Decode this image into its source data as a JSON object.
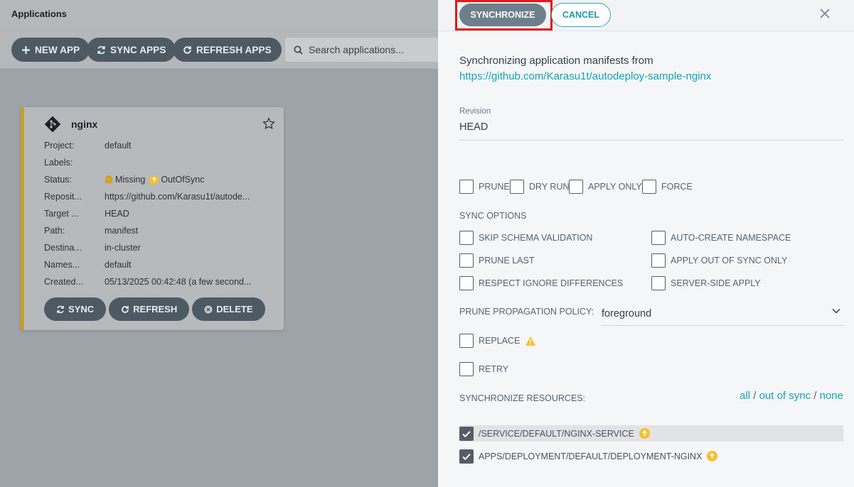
{
  "app_page": {
    "title": "Applications",
    "toolbar": {
      "new_app": "NEW APP",
      "sync_apps": "SYNC APPS",
      "refresh_apps": "REFRESH APPS",
      "search_placeholder": "Search applications..."
    },
    "card": {
      "name": "nginx",
      "rows": [
        {
          "key": "Project:",
          "value": "default"
        },
        {
          "key": "Labels:",
          "value": ""
        },
        {
          "key": "Status:",
          "value": ""
        },
        {
          "key": "Reposit...",
          "value": "https://github.com/Karasu1t/autode..."
        },
        {
          "key": "Target ...",
          "value": "HEAD"
        },
        {
          "key": "Path:",
          "value": "manifest"
        },
        {
          "key": "Destina...",
          "value": "in-cluster"
        },
        {
          "key": "Names...",
          "value": "default"
        },
        {
          "key": "Created...",
          "value": "05/13/2025 00:42:48  (a few second..."
        }
      ],
      "status_health": "Missing",
      "status_sync": "OutOfSync",
      "actions": {
        "sync": "SYNC",
        "refresh": "REFRESH",
        "delete": "DELETE"
      }
    }
  },
  "panel": {
    "synchronize_button": "SYNCHRONIZE",
    "cancel_button": "CANCEL",
    "intro": "Synchronizing application manifests from",
    "repo_url": "https://github.com/Karasu1t/autodeploy-sample-nginx",
    "revision_label": "Revision",
    "revision_value": "HEAD",
    "top_options": [
      "PRUNE",
      "DRY RUN",
      "APPLY ONLY",
      "FORCE"
    ],
    "sync_options_label": "SYNC OPTIONS",
    "sync_options_left": [
      "SKIP SCHEMA VALIDATION",
      "PRUNE LAST",
      "RESPECT IGNORE DIFFERENCES"
    ],
    "sync_options_right": [
      "AUTO-CREATE NAMESPACE",
      "APPLY OUT OF SYNC ONLY",
      "SERVER-SIDE APPLY"
    ],
    "prune_policy_label": "PRUNE PROPAGATION POLICY:",
    "prune_policy_value": "foreground",
    "replace_label": "REPLACE",
    "retry_label": "RETRY",
    "resources_label": "SYNCHRONIZE RESOURCES:",
    "resource_filters": {
      "all": "all",
      "sep1": " / ",
      "out_of_sync": "out of sync",
      "sep2": " / ",
      "none": "none"
    },
    "resources": [
      {
        "label": "/SERVICE/DEFAULT/NGINX-SERVICE",
        "checked": true
      },
      {
        "label": "APPS/DEPLOYMENT/DEFAULT/DEPLOYMENT-NGINX",
        "checked": true
      }
    ]
  },
  "colors": {
    "accent": "#15a3b5",
    "highlight": "#e01a1a",
    "warning": "#f4c030"
  }
}
